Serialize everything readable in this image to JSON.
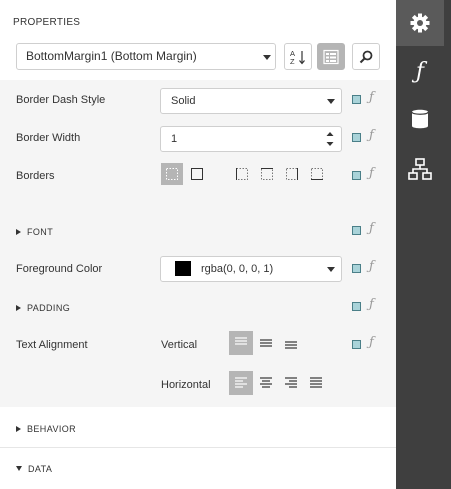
{
  "panel": {
    "title": "PROPERTIES",
    "component_select": "BottomMargin1 (Bottom Margin)"
  },
  "toolbar": {
    "sort_icon": "sort-az-icon",
    "categories_icon": "categorized-icon",
    "search_icon": "search-icon"
  },
  "properties": {
    "border_dash_style": {
      "label": "Border Dash Style",
      "value": "Solid"
    },
    "border_width": {
      "label": "Border Width",
      "value": "1"
    },
    "borders": {
      "label": "Borders"
    },
    "font_section": "FONT",
    "foreground_color": {
      "label": "Foreground Color",
      "value": "rgba(0, 0, 0, 1)",
      "swatch": "#000000"
    },
    "padding_section": "PADDING",
    "text_alignment": {
      "label": "Text Alignment",
      "vertical_label": "Vertical",
      "horizontal_label": "Horizontal"
    }
  },
  "sections": {
    "behavior": "BEHAVIOR",
    "data": "DATA"
  },
  "sidebar": {
    "items": [
      "gear-icon",
      "function-icon",
      "database-icon",
      "hierarchy-icon"
    ]
  },
  "colors": {
    "accent_square": "#a9d3d9",
    "sidebar_bg": "#3f3f3f",
    "active_btn": "#b5b5b5"
  }
}
